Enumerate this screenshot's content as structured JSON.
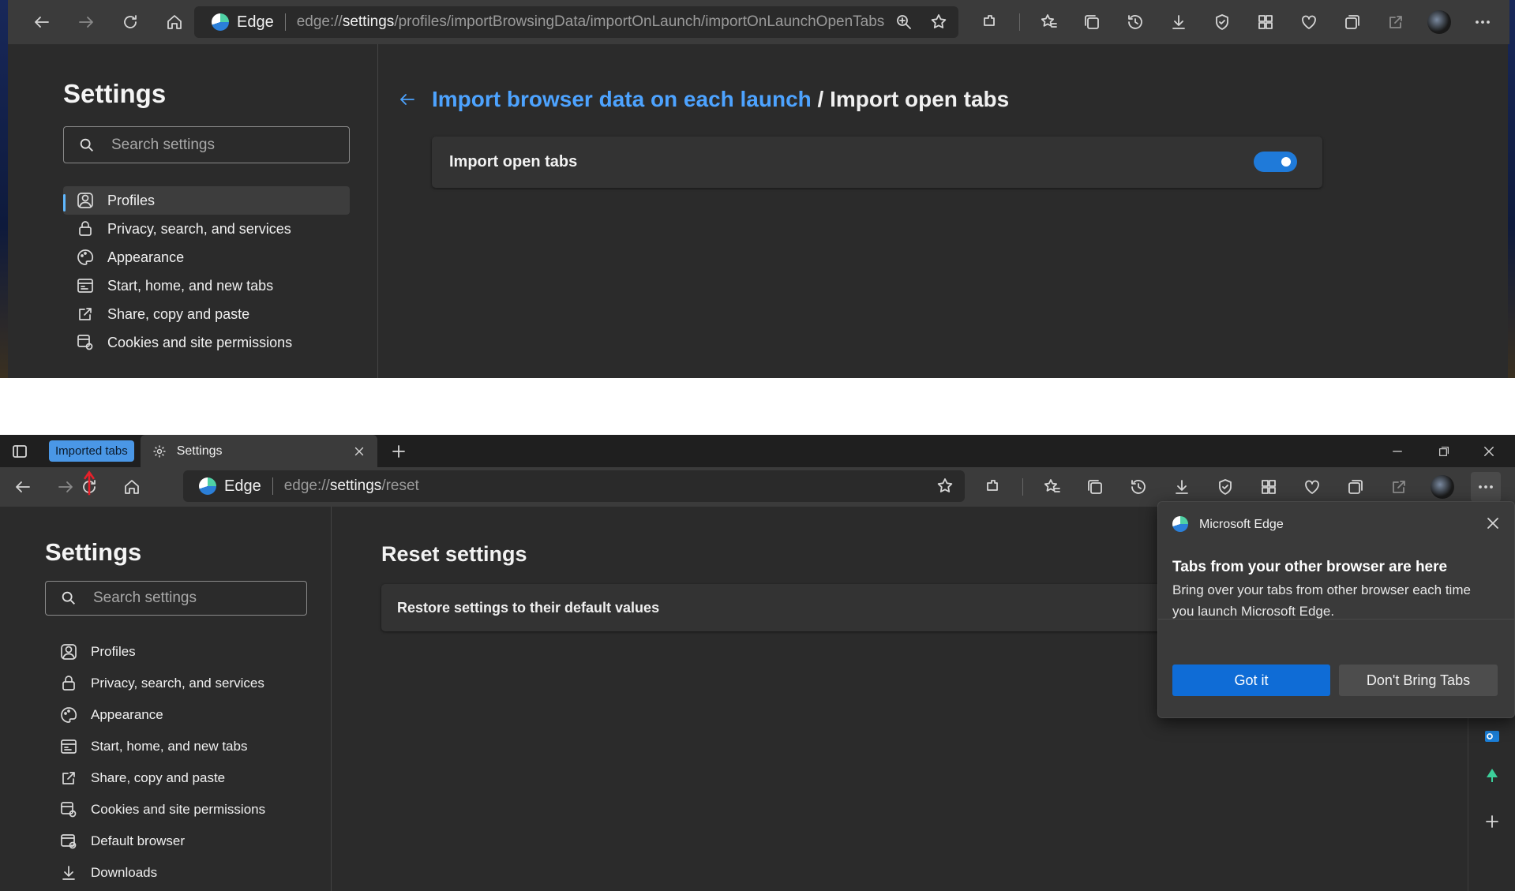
{
  "top": {
    "address": {
      "brand": "Edge",
      "url_prefix": "edge://",
      "url_host": "settings",
      "url_path": "/profiles/importBrowsingData/importOnLaunch/importOnLaunchOpenTabs"
    },
    "sidebar": {
      "title": "Settings",
      "search_placeholder": "Search settings",
      "items": [
        {
          "label": "Profiles",
          "icon": "profile-icon",
          "active": true
        },
        {
          "label": "Privacy, search, and services",
          "icon": "lock-icon"
        },
        {
          "label": "Appearance",
          "icon": "palette-icon"
        },
        {
          "label": "Start, home, and new tabs",
          "icon": "start-page-icon"
        },
        {
          "label": "Share, copy and paste",
          "icon": "share-icon"
        },
        {
          "label": "Cookies and site permissions",
          "icon": "cookie-permissions-icon"
        }
      ]
    },
    "main": {
      "breadcrumb_parent": "Import browser data on each launch",
      "breadcrumb_sep": "/",
      "breadcrumb_current": "Import open tabs",
      "setting_label": "Import open tabs",
      "toggle_on": true
    }
  },
  "bottom": {
    "tabs": [
      {
        "label": "Imported tabs",
        "type": "group-badge"
      },
      {
        "label": "Settings",
        "icon": "gear-icon"
      }
    ],
    "address": {
      "brand": "Edge",
      "url_prefix": "edge://",
      "url_host": "settings",
      "url_path": "/reset"
    },
    "sidebar": {
      "title": "Settings",
      "search_placeholder": "Search settings",
      "items": [
        {
          "label": "Profiles",
          "icon": "profile-icon"
        },
        {
          "label": "Privacy, search, and services",
          "icon": "lock-icon"
        },
        {
          "label": "Appearance",
          "icon": "palette-icon"
        },
        {
          "label": "Start, home, and new tabs",
          "icon": "start-page-icon"
        },
        {
          "label": "Share, copy and paste",
          "icon": "share-icon"
        },
        {
          "label": "Cookies and site permissions",
          "icon": "cookie-permissions-icon"
        },
        {
          "label": "Default browser",
          "icon": "default-browser-icon"
        },
        {
          "label": "Downloads",
          "icon": "download-icon"
        }
      ]
    },
    "main": {
      "title": "Reset settings",
      "row_label": "Restore settings to their default values"
    },
    "popup": {
      "app_name": "Microsoft Edge",
      "heading": "Tabs from your other browser are here",
      "body": "Bring over your tabs from other browser each time you launch Microsoft Edge.",
      "primary_button": "Got it",
      "secondary_button": "Don't Bring Tabs"
    },
    "colors": {
      "accent": "#0f6cd6",
      "link": "#4da3ff",
      "toggle": "#1f7ad9"
    }
  }
}
